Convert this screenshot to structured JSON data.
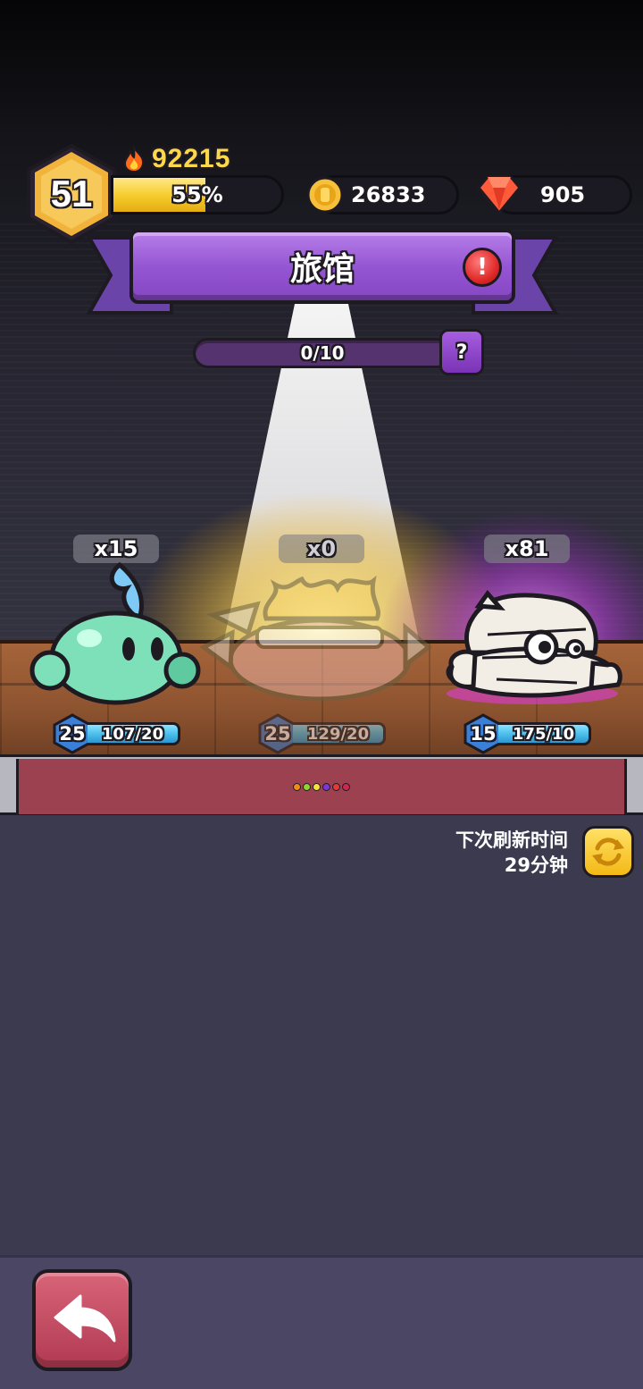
{
  "player": {
    "level": "51",
    "power": "92215",
    "xp_percent": "55%",
    "xp_fraction": 0.55
  },
  "resources": {
    "coins": "26833",
    "gems": "905"
  },
  "header": {
    "title": "旅馆"
  },
  "progress": {
    "label": "0/10",
    "fraction": 0,
    "help_label": "?"
  },
  "monsters": [
    {
      "count": "x15",
      "level": "25",
      "stat": "107/20",
      "element": "water",
      "available": true
    },
    {
      "count": "x0",
      "level": "25",
      "stat": "129/20",
      "element": "light",
      "available": false
    },
    {
      "count": "x81",
      "level": "15",
      "stat": "175/10",
      "element": "dark",
      "available": true
    }
  ],
  "carousel": {
    "dot_colors": [
      "#f08a1a",
      "#8fd62b",
      "#f4e23a",
      "#7a39d6",
      "#e23a3a",
      "#d2264f"
    ]
  },
  "refresh": {
    "line1": "下次刷新时间",
    "line2": "29分钟"
  },
  "icons": {
    "level": "hexagon-badge-icon",
    "power": "flame-icon",
    "coins": "gold-coin-icon",
    "gems": "ruby-gem-icon",
    "alert": "exclamation-icon",
    "refresh": "refresh-arrows-icon",
    "back": "back-arrow-icon"
  },
  "colors": {
    "accent_purple": "#9556d3",
    "xp_yellow": "#f6cd2e",
    "back_button": "#c04a62",
    "stat_blue": "#4cbfec"
  }
}
